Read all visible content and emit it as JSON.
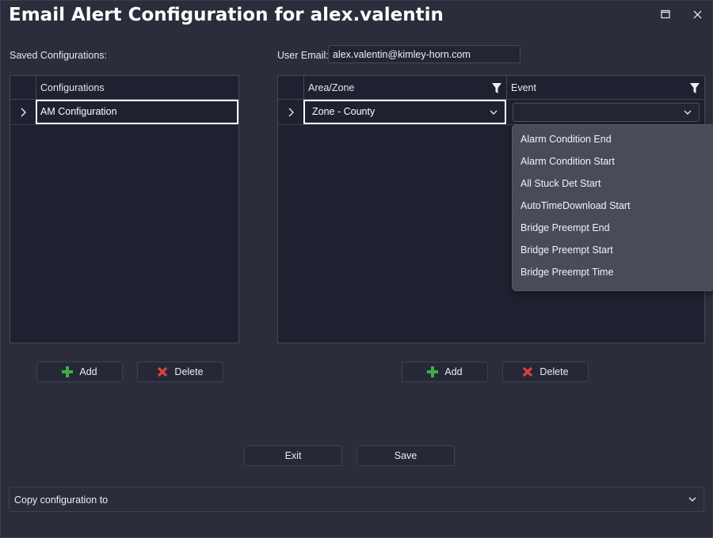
{
  "window": {
    "title": "Email Alert Configuration for alex.valentin",
    "maximize_icon": "maximize-icon",
    "close_icon": "close-icon"
  },
  "left": {
    "label": "Saved Configurations:",
    "column_header": "Configurations",
    "rows": [
      {
        "name": "AM Configuration"
      }
    ],
    "add_label": "Add",
    "delete_label": "Delete"
  },
  "right": {
    "email_label": "User Email:",
    "email_value": "alex.valentin@kimley-horn.com",
    "columns": [
      "Area/Zone",
      "Event"
    ],
    "rows": [
      {
        "area_zone": "Zone - County",
        "event": ""
      }
    ],
    "event_options": [
      "Alarm Condition End",
      "Alarm Condition Start",
      "All Stuck Det Start",
      "AutoTimeDownload Start",
      "Bridge Preempt End",
      "Bridge Preempt Start",
      "Bridge Preempt Time"
    ],
    "add_label": "Add",
    "delete_label": "Delete"
  },
  "footer": {
    "exit_label": "Exit",
    "save_label": "Save",
    "copy_placeholder": "Copy configuration to"
  },
  "colors": {
    "background": "#2b2d3a",
    "grid_background": "#1f2130",
    "add_green": "#3cb043",
    "delete_red": "#e0413a",
    "dropdown_bg": "#4a4b58"
  }
}
